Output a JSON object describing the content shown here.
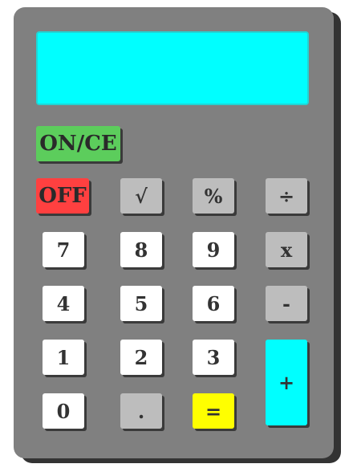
{
  "display": {
    "value": ""
  },
  "buttons": {
    "on_ce": "ON/CE",
    "off": "OFF",
    "sqrt": "√",
    "percent": "%",
    "divide": "÷",
    "seven": "7",
    "eight": "8",
    "nine": "9",
    "multiply": "x",
    "four": "4",
    "five": "5",
    "six": "6",
    "minus": "-",
    "one": "1",
    "two": "2",
    "three": "3",
    "plus": "+",
    "zero": "0",
    "decimal": ".",
    "equals": "="
  },
  "colors": {
    "body": "#808080",
    "display": "#00ffff",
    "on_button": "#5ccd5c",
    "off_button": "#ff4040",
    "number_button": "#ffffff",
    "operator_button": "#bdbdbd",
    "equals_button": "#ffff00",
    "plus_button": "#00ffff"
  }
}
